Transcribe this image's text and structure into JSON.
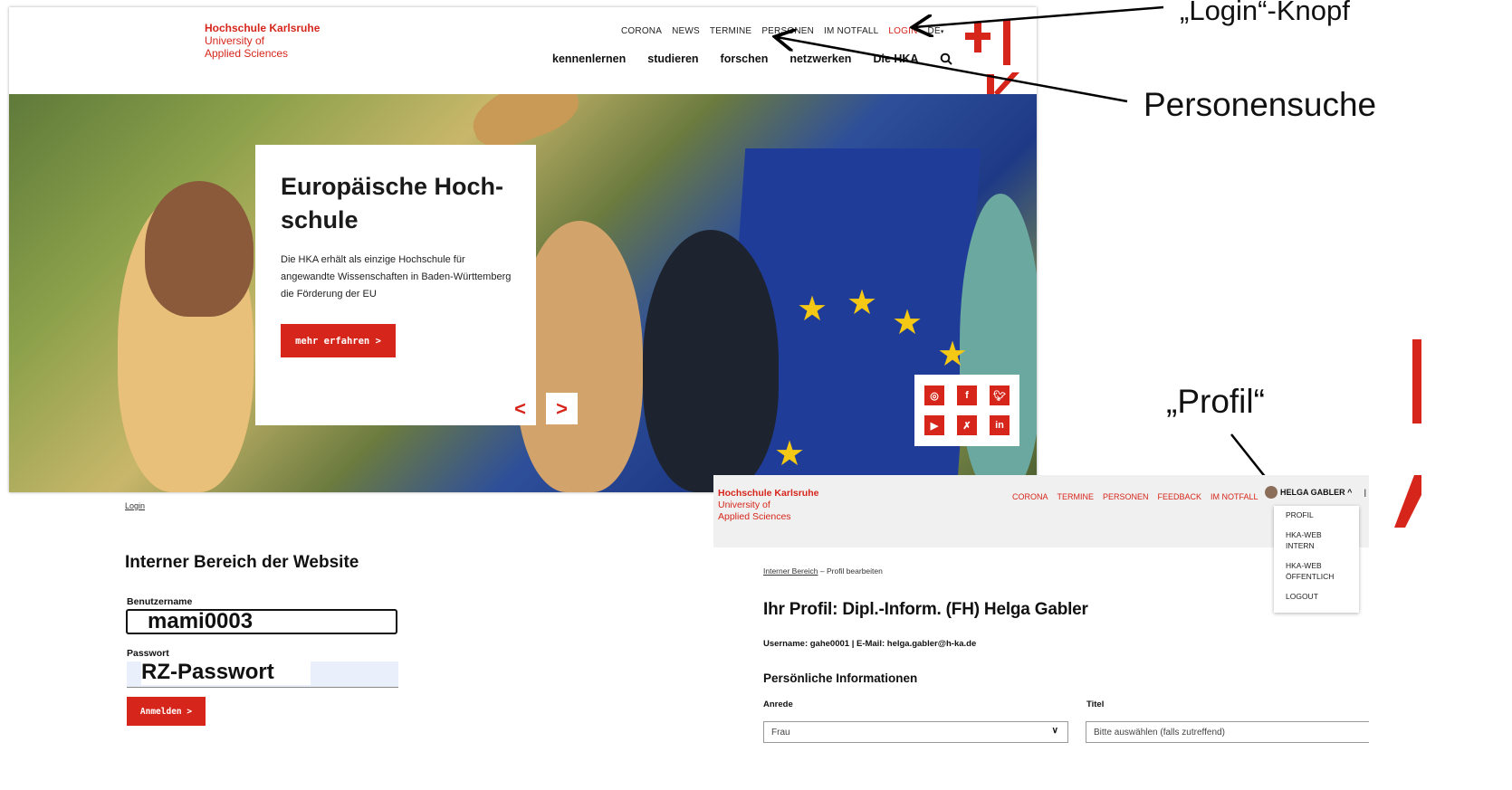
{
  "annotations": {
    "login_knopf": "„Login“-Knopf",
    "personensuche": "Personensuche",
    "profil": "„Profil“"
  },
  "site": {
    "brand_line1": "Hochschule Karlsruhe",
    "brand_line2": "University of",
    "brand_line3": "Applied Sciences",
    "top_nav": [
      "CORONA",
      "NEWS",
      "TERMINE",
      "PERSONEN",
      "IM NOTFALL",
      "LOGIN",
      "DE"
    ],
    "main_nav": [
      "kennenlernen",
      "studieren",
      "forschen",
      "netzwerken",
      "Die HKA"
    ],
    "logo_text": "HKA",
    "hero": {
      "title_line1": "Europäische Hoch-",
      "title_line2": "schule",
      "text": "Die HKA erhält als einzige Hochschule für angewandte Wissenschaften in Baden-Württemberg die Förderung der EU",
      "button": "mehr erfahren  >",
      "prev": "<",
      "next": ">"
    },
    "social_icons": [
      "instagram-icon",
      "facebook-icon",
      "twitter-icon",
      "youtube-icon",
      "xing-icon",
      "linkedin-icon"
    ],
    "accent_color": "#d6261b"
  },
  "login_form": {
    "breadcrumb": "Login",
    "title": "Interner Bereich der Website",
    "username_label": "Benutzername",
    "username_value": "mami0003",
    "password_label": "Passwort",
    "password_value": "RZ-Passwort",
    "submit": "Anmelden  >"
  },
  "profile_page": {
    "brand_line1": "Hochschule Karlsruhe",
    "brand_line2": "University of",
    "brand_line3": "Applied Sciences",
    "nav": [
      "CORONA",
      "TERMINE",
      "PERSONEN",
      "FEEDBACK",
      "IM NOTFALL"
    ],
    "user_menu": "HELGA GABLER ^",
    "dropdown": [
      "PROFIL",
      "HKA-WEB INTERN",
      "HKA-WEB ÖFFENTLICH",
      "LOGOUT"
    ],
    "breadcrumb_link": "Interner Bereich",
    "breadcrumb_sep": "–",
    "breadcrumb_current": "Profil bearbeiten",
    "title": "Ihr Profil: Dipl.-Inform. (FH) Helga Gabler",
    "user_info": "Username: gahe0001 | E-Mail: helga.gabler@h-ka.de",
    "section": "Persönliche Informationen",
    "anrede_label": "Anrede",
    "anrede_value": "Frau",
    "titel_label": "Titel",
    "titel_placeholder": "Bitte auswählen (falls zutreffend)"
  }
}
